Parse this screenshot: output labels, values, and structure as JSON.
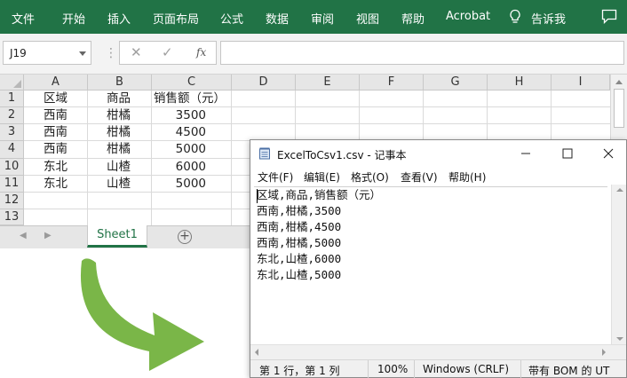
{
  "ribbon": {
    "tabs": [
      "文件",
      "开始",
      "插入",
      "页面布局",
      "公式",
      "数据",
      "审阅",
      "视图",
      "帮助",
      "Acrobat",
      "告诉我"
    ]
  },
  "formula_bar": {
    "name_box": "J19",
    "formula_value": ""
  },
  "sheet": {
    "columns": [
      "A",
      "B",
      "C",
      "D",
      "E",
      "F",
      "G",
      "H",
      "I"
    ],
    "rows": [
      "1",
      "2",
      "3",
      "4",
      "10",
      "11",
      "12",
      "13"
    ],
    "cells": [
      [
        "区域",
        "商品",
        "销售额（元）"
      ],
      [
        "西南",
        "柑橘",
        "3500"
      ],
      [
        "西南",
        "柑橘",
        "4500"
      ],
      [
        "西南",
        "柑橘",
        "5000"
      ],
      [
        "东北",
        "山楂",
        "6000"
      ],
      [
        "东北",
        "山楂",
        "5000"
      ]
    ],
    "tab_name": "Sheet1"
  },
  "notepad": {
    "title": "ExcelToCsv1.csv - 记事本",
    "menu": [
      "文件(F)",
      "编辑(E)",
      "格式(O)",
      "查看(V)",
      "帮助(H)"
    ],
    "lines": [
      "区域,商品,销售额（元）",
      "西南,柑橘,3500",
      "西南,柑橘,4500",
      "西南,柑橘,5000",
      "东北,山楂,6000",
      "东北,山楂,5000"
    ],
    "status": {
      "position": "第 1 行，第 1 列",
      "zoom": "100%",
      "line_ending": "Windows (CRLF)",
      "encoding": "带有 BOM 的 UT"
    }
  },
  "colors": {
    "excel_green": "#217346",
    "arrow_green": "#7ab648"
  }
}
